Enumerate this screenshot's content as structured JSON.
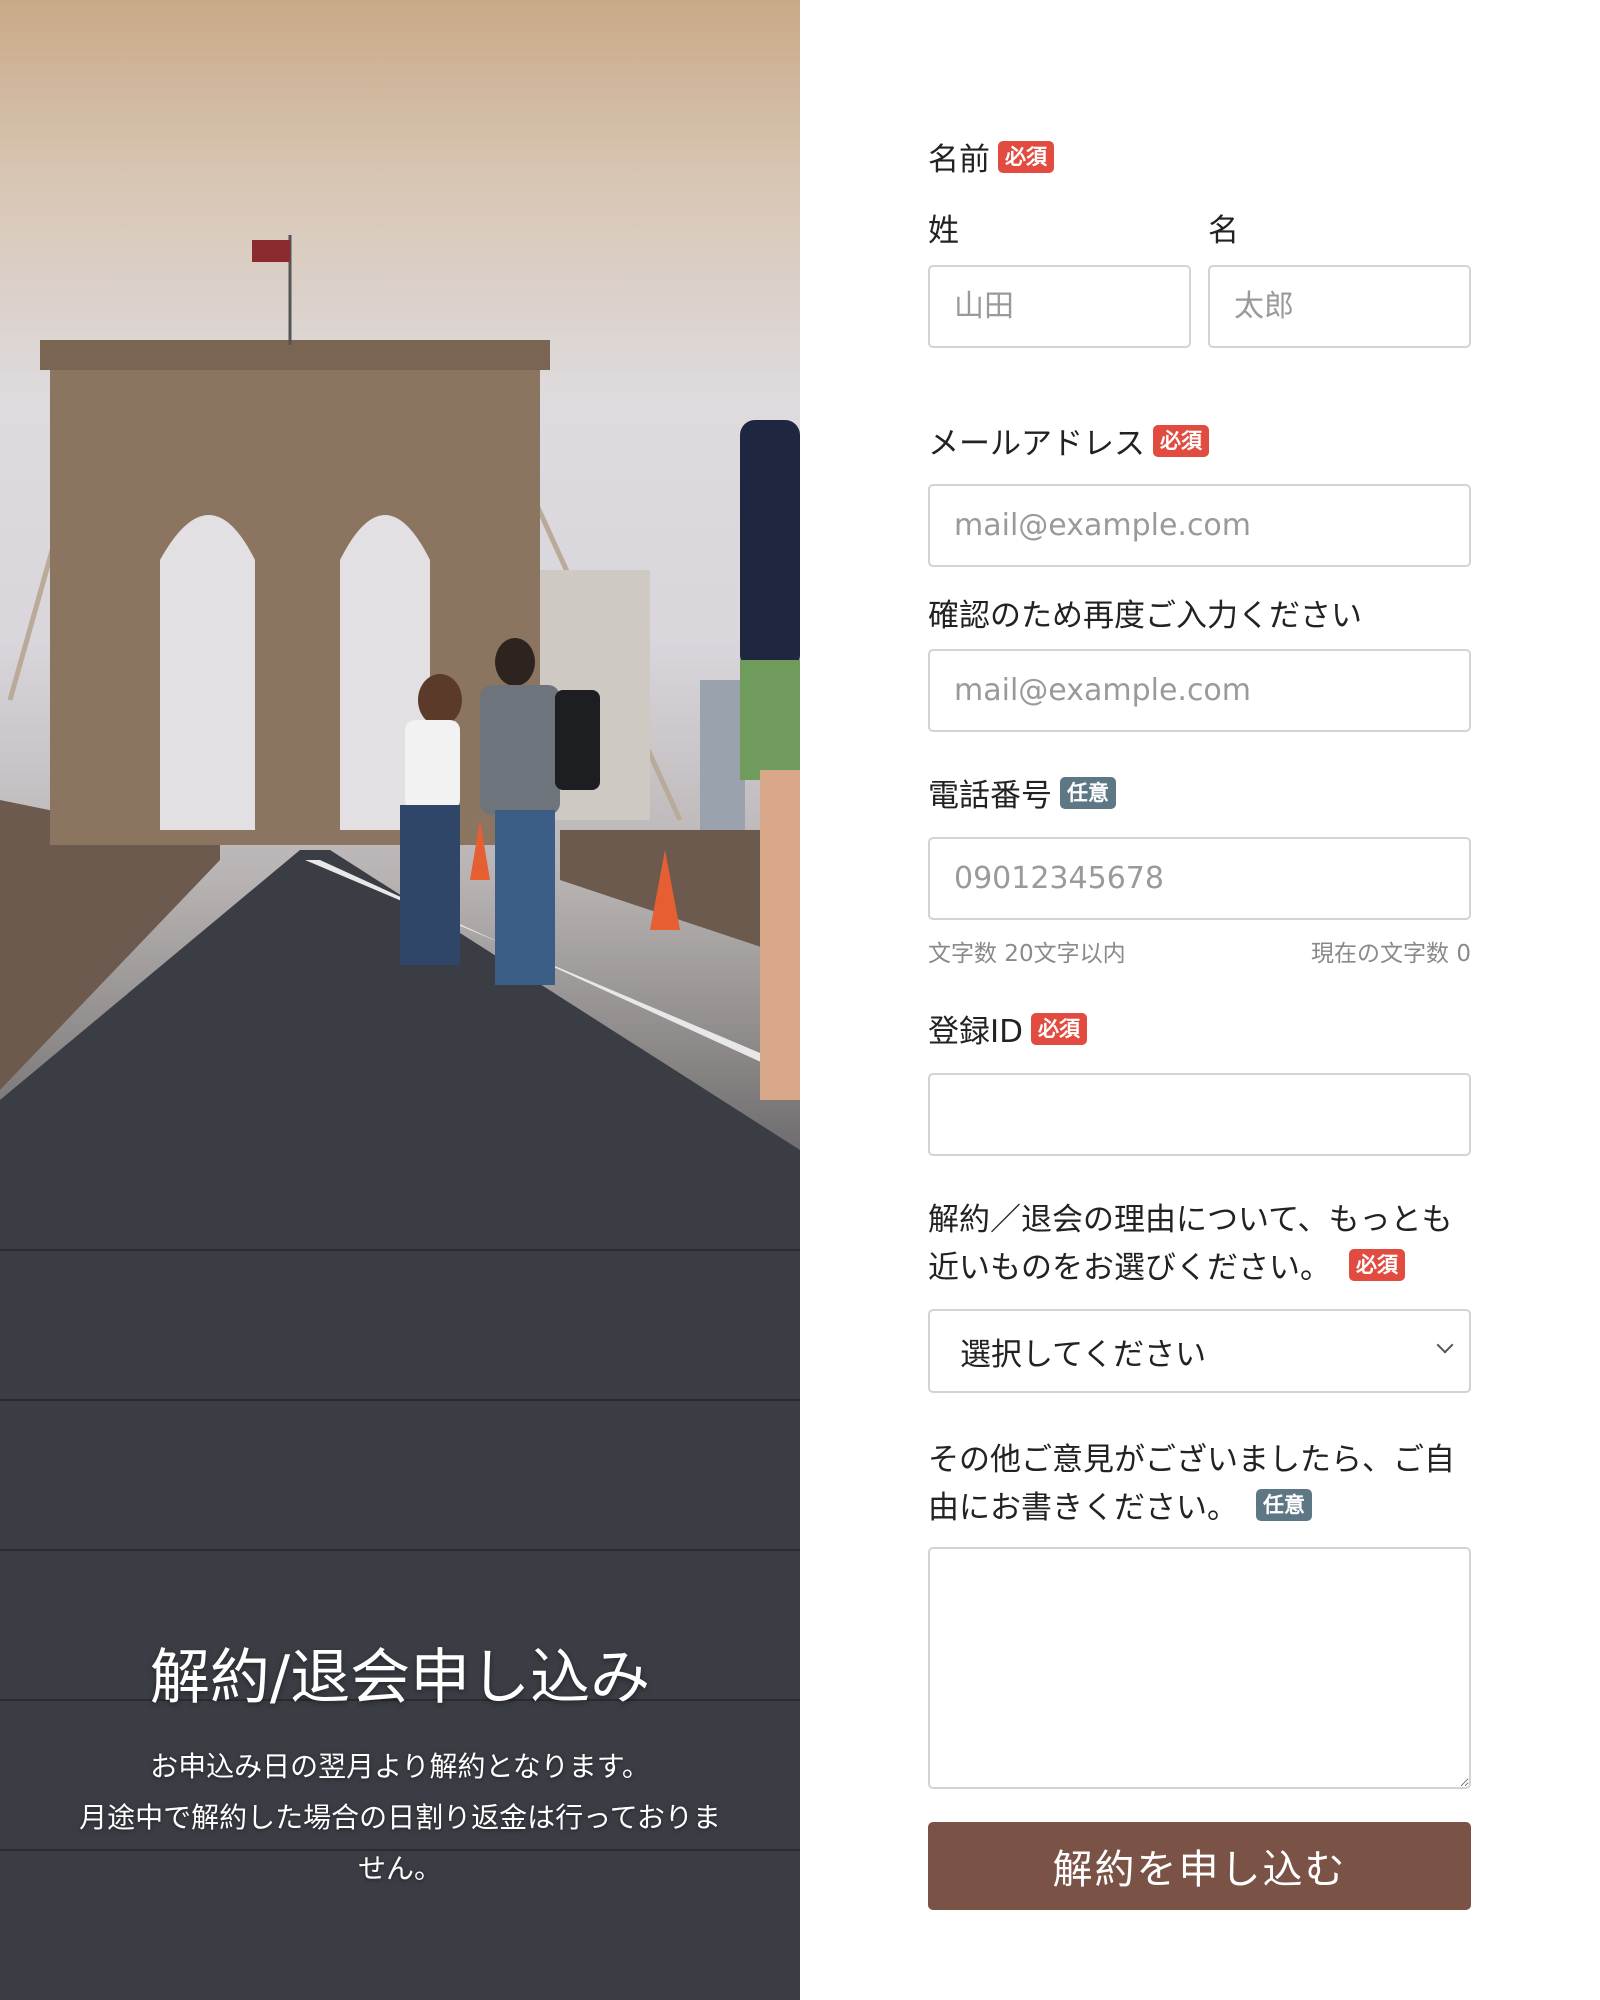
{
  "hero": {
    "title": "解約/退会申し込み",
    "description_line1": "お申込み日の翌月より解約となります。",
    "description_line2": "月途中で解約した場合の日割り返金は行っておりま",
    "description_line3": "せん。",
    "image": "brooklyn-bridge-photo"
  },
  "form": {
    "name": {
      "label": "名前",
      "badge": "必須",
      "last_label": "姓",
      "first_label": "名",
      "last_placeholder": "山田",
      "first_placeholder": "太郎"
    },
    "email": {
      "label": "メールアドレス",
      "badge": "必須",
      "placeholder": "mail@example.com",
      "confirm_label": "確認のため再度ご入力ください",
      "confirm_placeholder": "mail@example.com"
    },
    "phone": {
      "label": "電話番号",
      "badge": "任意",
      "placeholder": "09012345678",
      "limit_text": "文字数 20文字以内",
      "count_text": "現在の文字数 0"
    },
    "member_id": {
      "label": "登録ID",
      "badge": "必須"
    },
    "reason": {
      "label_line1": "解約／退会の理由について、もっとも",
      "label_line2": "近いものをお選びください。",
      "badge": "必須",
      "selected": "選択してください"
    },
    "comment": {
      "label_line1": "その他ご意見がございましたら、ご自",
      "label_line2": "由にお書きください。",
      "badge": "任意"
    },
    "submit_label": "解約を申し込む"
  },
  "colors": {
    "required_badge": "#e24b3f",
    "optional_badge": "#5d7785",
    "submit_button": "#7b5246"
  }
}
